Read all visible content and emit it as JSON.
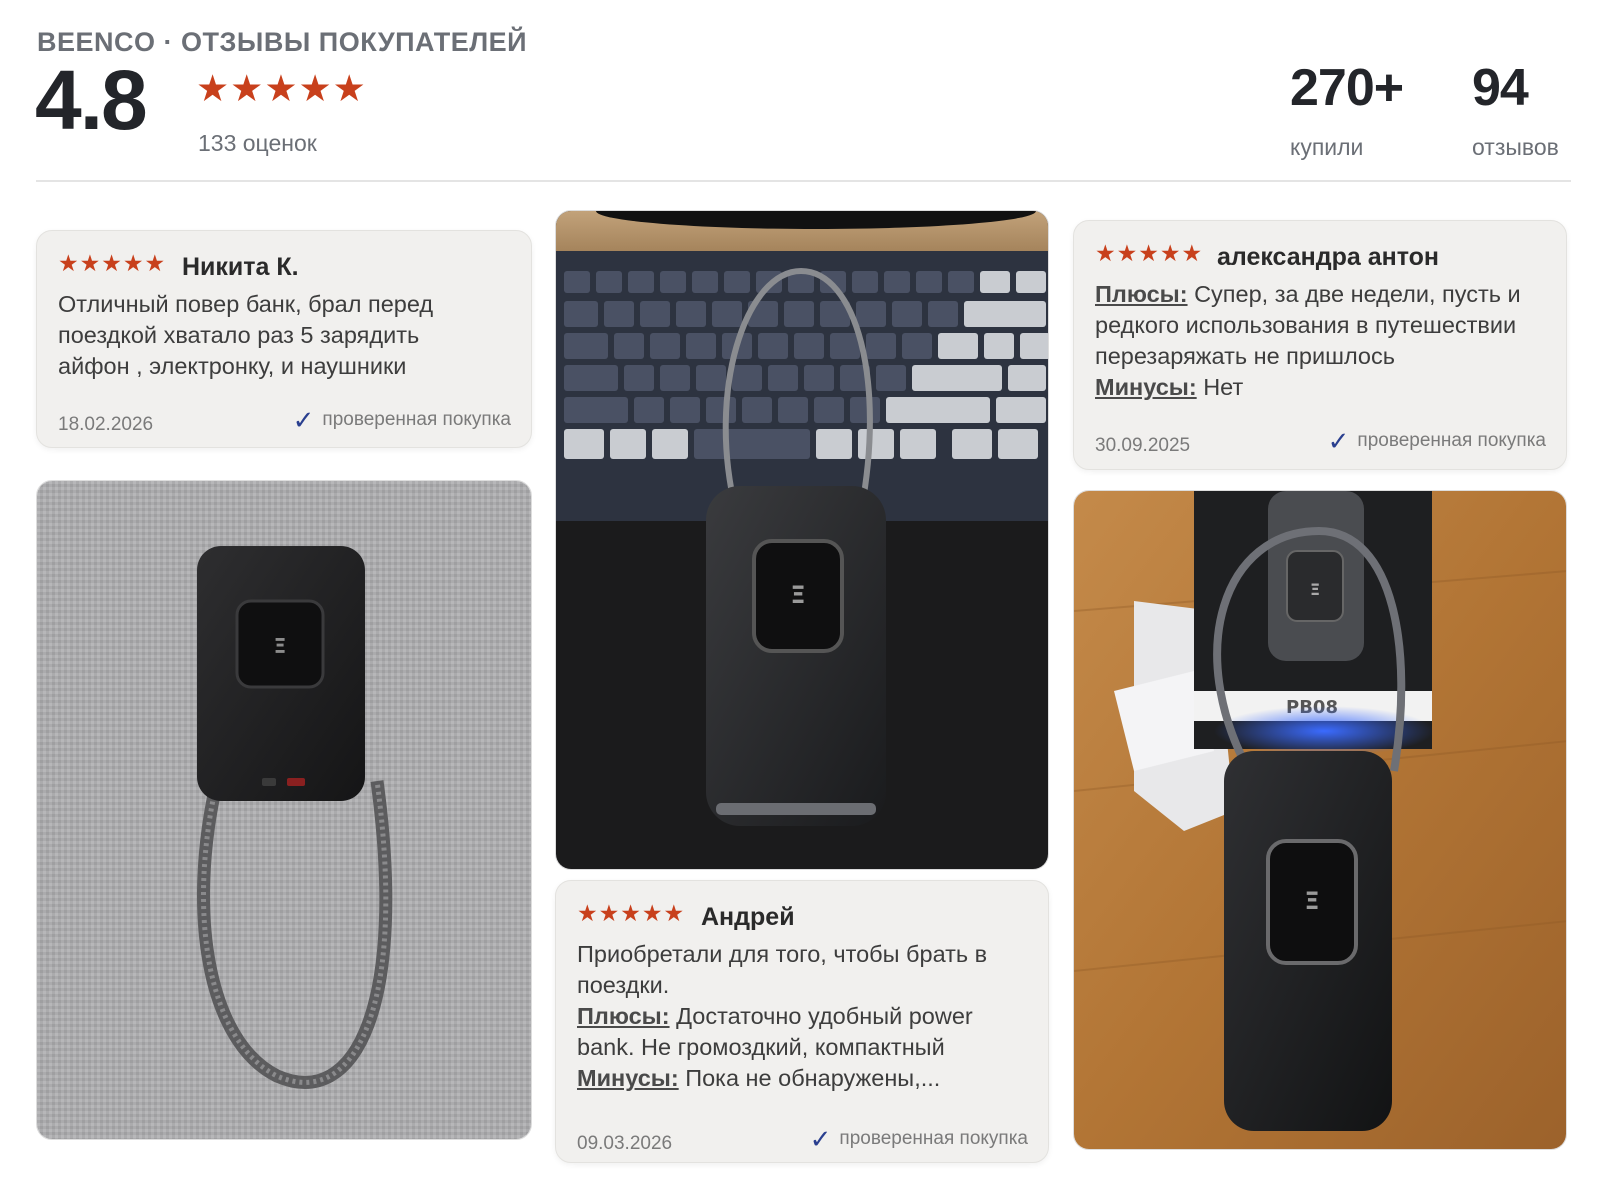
{
  "header": {
    "brand_title": "BEENCO · ОТЗЫВЫ ПОКУПАТЕЛЕЙ",
    "rating": "4.8",
    "stars": "★★★★★",
    "ratings_count": "133 оценок",
    "bought_value": "270+",
    "bought_label": "купили",
    "reviews_value": "94",
    "reviews_label": "отзывов"
  },
  "reviews": [
    {
      "stars": "★★★★★",
      "rating": 5,
      "author": "Никита К.",
      "text_lines": [
        "Отличный повер банк, брал перед",
        "поездкой хватало раз 5 зарядить",
        "айфон , электронку, и наушники"
      ],
      "date": "18.02.2026",
      "verified": "проверенная покупка"
    },
    {
      "stars": "★★★★★",
      "rating": 5,
      "author": "Андрей",
      "text_line1": "Приобретали для того, чтобы брать в",
      "text_line2": "поездки.",
      "pros_label": "Плюсы:",
      "pros_line1": " Достаточно удобный power",
      "pros_line2": "bank. Не громоздкий, компактный",
      "cons_label": "Минусы:",
      "cons_text": " Пока не обнаружены,...",
      "date": "09.03.2026",
      "verified": "проверенная покупка"
    },
    {
      "stars": "★★★★★",
      "rating": 5,
      "author": "александра антон",
      "pros_label": "Плюсы:",
      "pros_line1": " Супер, за две недели, пусть и",
      "pros_line2": "редкого использования в путешествии",
      "pros_line3": "перезаряжать не пришлось",
      "cons_label": "Минусы:",
      "cons_text": " Нет",
      "date": "30.09.2025",
      "verified": "проверенная покупка"
    }
  ],
  "photos": {
    "box_label": "PB08"
  },
  "colors": {
    "star": "#c8401c",
    "check": "#2a3f8f",
    "card_bg": "#f1f0ee"
  }
}
